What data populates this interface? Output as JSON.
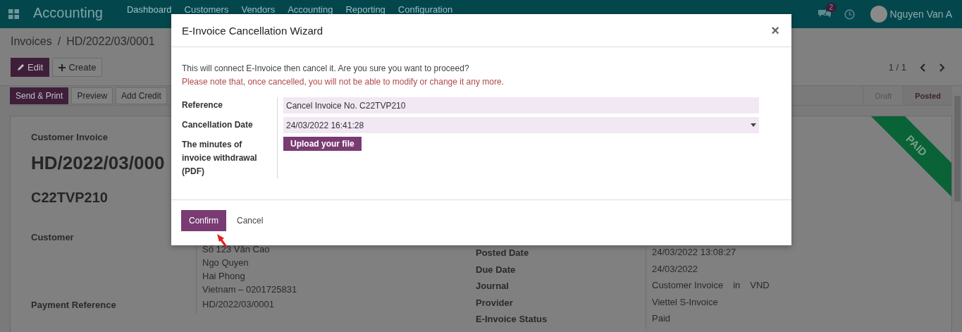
{
  "topbar": {
    "app_title": "Accounting",
    "menu": [
      "Dashboard",
      "Customers",
      "Vendors",
      "Accounting",
      "Reporting",
      "Configuration"
    ],
    "messages_badge": "2",
    "user": "Nguyen Van A"
  },
  "breadcrumb": {
    "parent": "Invoices",
    "separator": "/",
    "current": "HD/2022/03/0001"
  },
  "actions": [
    {
      "label": "Edit",
      "kind": "primary"
    },
    {
      "label": "Create",
      "kind": "secondary"
    }
  ],
  "pager": "1 / 1",
  "header_buttons": [
    {
      "label": "Send & Print",
      "kind": "primary"
    },
    {
      "label": "Preview",
      "kind": "secondary"
    },
    {
      "label": "Add Credit",
      "kind": "secondary"
    }
  ],
  "statuses": [
    {
      "label": "Draft",
      "selected": false
    },
    {
      "label": "Posted",
      "selected": true
    }
  ],
  "sheet": {
    "ribbon": "PAID",
    "type_label": "Customer Invoice",
    "name": "HD/2022/03/000",
    "number": "C22TVP210",
    "left_fields": [
      {
        "label": "Customer",
        "kind": "address",
        "lines": [
          "Số 123 Văn Cao",
          "Ngo Quyen",
          "Hai Phong",
          "Vietnam – 0201725831"
        ]
      },
      {
        "label": "Payment Reference",
        "kind": "text",
        "lines": [
          "HD/2022/03/0001"
        ]
      }
    ],
    "right_fields": [
      {
        "label": "Posted Date",
        "values": [
          "24/03/2022 13:08:27"
        ]
      },
      {
        "label": "Due Date",
        "values": [
          "24/03/2022"
        ]
      },
      {
        "label": "Journal",
        "values": [
          "Customer Invoice",
          "in",
          "VND"
        ]
      },
      {
        "label": "Provider",
        "values": [
          "Viettel S-Invoice"
        ]
      },
      {
        "label": "E-Invoice Status",
        "values": [
          "Paid"
        ]
      }
    ]
  },
  "dialog": {
    "title": "E-Invoice Cancellation Wizard",
    "close": "×",
    "message": "This will connect E-Invoice then cancel it. Are you sure you want to proceed?",
    "warning": "Please note that, once cancelled, you will not be able to modify or change it any more.",
    "fields": [
      {
        "label": "Reference",
        "kind": "text",
        "value": "Cancel Invoice No. C22TVP210"
      },
      {
        "label": "Cancellation Date",
        "kind": "datetime",
        "value": "24/03/2022 16:41:28"
      },
      {
        "label": "The minutes of invoice withdrawal (PDF)",
        "kind": "upload",
        "value": "Upload your file"
      }
    ],
    "buttons": [
      {
        "label": "Confirm",
        "kind": "primary"
      },
      {
        "label": "Cancel",
        "kind": "link"
      }
    ]
  }
}
